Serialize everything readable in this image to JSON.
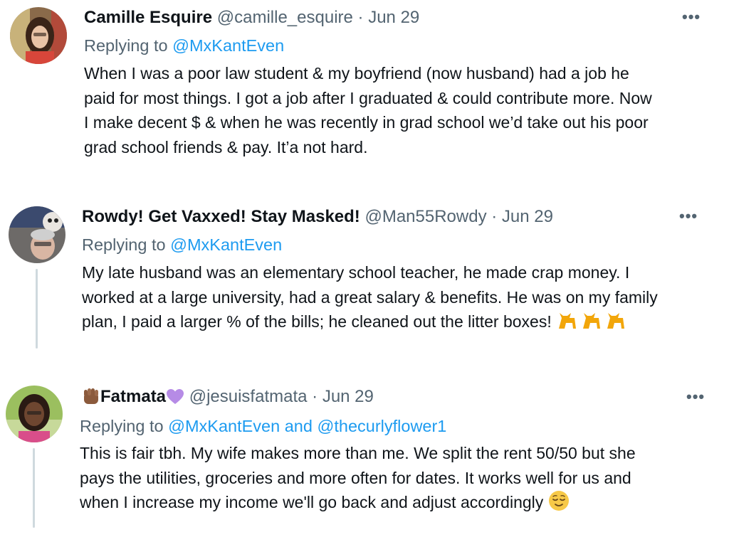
{
  "tweets": [
    {
      "name": "Camille Esquire",
      "handle": "@camille_esquire",
      "separator": "·",
      "date": "Jun 29",
      "replying_prefix": "Replying to",
      "replying_to": "@MxKantEven",
      "text": "When I was a poor law student & my boyfriend (now husband) had a job he\npaid for most things.  I got a job after I graduated & could contribute more. Now\nI make decent $ & when he was recently in grad school we’d take out his poor\ngrad school friends & pay. It’a not hard.",
      "more_icon": "more-dots-icon",
      "avatar_icon": "avatar-photo"
    },
    {
      "name": "Rowdy! Get Vaxxed! Stay Masked!",
      "handle": "@Man55Rowdy",
      "separator": "·",
      "date": "Jun 29",
      "replying_prefix": "Replying to",
      "replying_to": "@MxKantEven",
      "text": "My late husband was an elementary school teacher, he made crap money. I\nworked at a large university, had a great salary & benefits. He was on my family\nplan, I paid a larger % of the bills; he cleaned out the litter boxes!",
      "emoji": "cat-emoji",
      "more_icon": "more-dots-icon",
      "avatar_icon": "avatar-photo"
    },
    {
      "name": "Fatmata",
      "name_prefix_emoji": "raised-fist-emoji",
      "name_suffix_emoji": "purple-heart-emoji",
      "handle": "@jesuisfatmata",
      "separator": "·",
      "date": "Jun 29",
      "replying_prefix": "Replying to",
      "replying_to": "@MxKantEven",
      "replying_joiner": "and",
      "replying_to_2": "@thecurlyflower1",
      "text": "This is fair tbh. My wife makes more than me. We split the rent 50/50 but she\npays the utilities, groceries and more often for dates. It works well for us and\nwhen I increase my income we'll go back and adjust accordingly",
      "emoji": "relieved-face-emoji",
      "more_icon": "more-dots-icon",
      "avatar_icon": "avatar-photo"
    }
  ],
  "colors": {
    "text": "#0f1419",
    "muted": "#536471",
    "link": "#1d9bf0",
    "thread_line": "#cfd9de"
  }
}
